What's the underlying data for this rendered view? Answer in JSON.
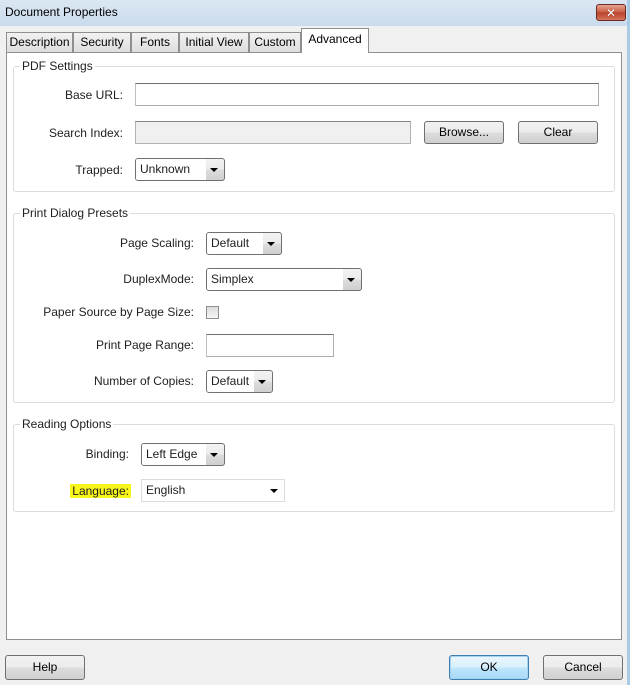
{
  "window": {
    "title": "Document Properties",
    "close_icon": "close-icon"
  },
  "tabs": [
    {
      "label": "Description",
      "active": false
    },
    {
      "label": "Security",
      "active": false
    },
    {
      "label": "Fonts",
      "active": false
    },
    {
      "label": "Initial View",
      "active": false
    },
    {
      "label": "Custom",
      "active": false
    },
    {
      "label": "Advanced",
      "active": true
    }
  ],
  "pdf_settings": {
    "title": "PDF Settings",
    "base_url": {
      "label": "Base URL:",
      "value": ""
    },
    "search_index": {
      "label": "Search Index:",
      "value": "",
      "disabled": true
    },
    "browse_label": "Browse...",
    "clear_label": "Clear",
    "trapped": {
      "label": "Trapped:",
      "value": "Unknown"
    }
  },
  "print_presets": {
    "title": "Print Dialog Presets",
    "page_scaling": {
      "label": "Page Scaling:",
      "value": "Default"
    },
    "duplex_mode": {
      "label": "DuplexMode:",
      "value": "Simplex"
    },
    "paper_source": {
      "label": "Paper Source by Page Size:",
      "checked": false
    },
    "page_range": {
      "label": "Print Page Range:",
      "value": ""
    },
    "copies": {
      "label": "Number of Copies:",
      "value": "Default"
    }
  },
  "reading_options": {
    "title": "Reading Options",
    "binding": {
      "label": "Binding:",
      "value": "Left Edge"
    },
    "language": {
      "label": "Language:",
      "value": "English",
      "highlight_color": "#f7f51a"
    }
  },
  "footer": {
    "help_label": "Help",
    "ok_label": "OK",
    "cancel_label": "Cancel"
  }
}
